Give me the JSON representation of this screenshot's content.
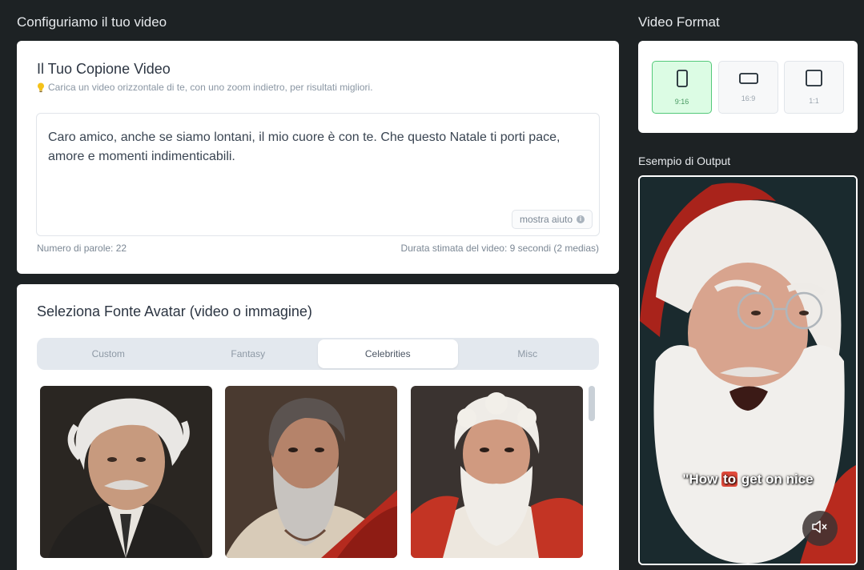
{
  "page": {
    "heading": "Configuriamo il tuo video"
  },
  "script": {
    "title": "Il Tuo Copione Video",
    "tip": "Carica un video orizzontale di te, con uno zoom indietro, per risultati migliori.",
    "text": "Caro amico, anche se siamo lontani, il mio cuore è con te. Che questo Natale ti porti pace, amore e momenti indimenticabili.",
    "help_label": "mostra aiuto",
    "word_count": "Numero di parole: 22",
    "duration": "Durata stimata del video: 9 secondi (2 medias)"
  },
  "avatar": {
    "title": "Seleziona Fonte Avatar (video o immagine)",
    "tabs": [
      "Custom",
      "Fantasy",
      "Celebrities",
      "Misc"
    ],
    "active_tab": "Celebrities"
  },
  "format": {
    "title": "Video Format",
    "options": [
      "9:16",
      "16:9",
      "1:1"
    ],
    "selected": "9:16"
  },
  "output": {
    "title": "Esempio di Output",
    "caption_prefix": "\"How ",
    "caption_highlight": "to",
    "caption_suffix": " get on nice"
  },
  "colors": {
    "background": "#1d2224",
    "accent_green": "#54c97a",
    "selected_green_bg": "#dcfce4",
    "caption_highlight": "#e24a3b"
  }
}
